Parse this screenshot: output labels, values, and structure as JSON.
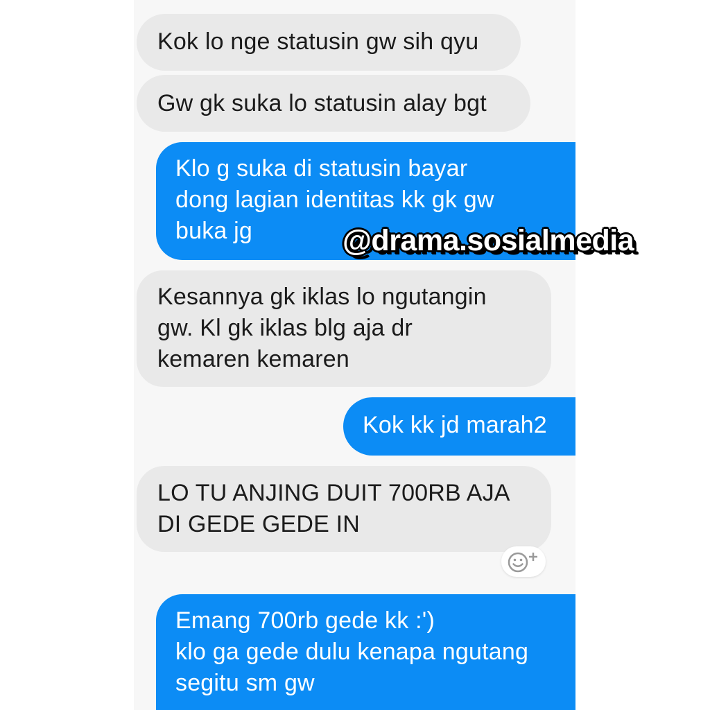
{
  "conversation": {
    "messages": [
      {
        "direction": "incoming",
        "text": "Kok lo nge statusin gw sih qyu"
      },
      {
        "direction": "incoming",
        "text": "Gw gk suka lo statusin alay bgt"
      },
      {
        "direction": "outgoing",
        "text": "Klo  g suka di statusin bayar\ndong lagian identitas kk gk gw\nbuka jg"
      },
      {
        "direction": "incoming",
        "text": "Kesannya gk iklas lo ngutangin\ngw. Kl gk iklas blg aja dr\nkemaren kemaren"
      },
      {
        "direction": "outgoing",
        "text": "Kok kk jd marah2"
      },
      {
        "direction": "incoming",
        "text": "LO TU ANJING DUIT 700RB AJA\nDI GEDE GEDE IN"
      },
      {
        "direction": "outgoing",
        "text": "Emang 700rb gede kk :')\nklo ga gede dulu kenapa ngutang\nsegitu sm gw"
      }
    ]
  },
  "reaction_button": {
    "icon": "smiley-plus-icon"
  },
  "watermark": {
    "text": "@drama.sosialmedia"
  },
  "colors": {
    "incoming_bubble": "#e9e9e9",
    "outgoing_bubble": "#0c8cf5",
    "chat_background": "#f7f7f7"
  }
}
